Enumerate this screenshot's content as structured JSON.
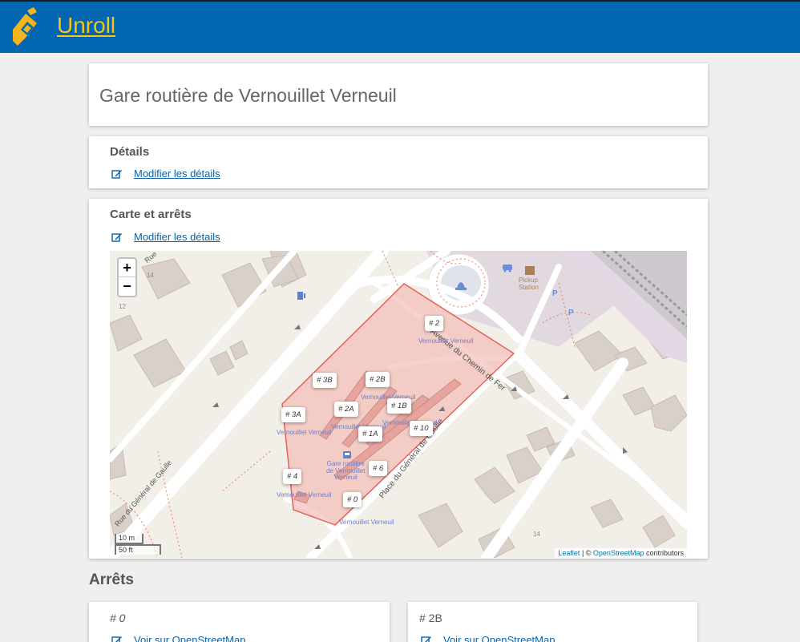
{
  "app": {
    "name": "Unroll"
  },
  "page": {
    "title": "Gare routière de Vernouillet Verneuil"
  },
  "details": {
    "heading": "Détails",
    "edit_link": "Modifier les détails"
  },
  "map_section": {
    "heading": "Carte et arrêts",
    "edit_link": "Modifier les détails",
    "zoom_in": "+",
    "zoom_out": "−",
    "scale_metric": "10 m",
    "scale_imperial": "50 ft",
    "attribution": {
      "leaflet": "Leaflet",
      "sep": " | © ",
      "osm": "OpenStreetMap",
      "suffix": " contributors"
    },
    "street_labels": {
      "avenue": "Avenue du Chemin de Fer",
      "place": "Place du Général de Gaulle",
      "rue_gaulle": "Rue du Général de Gaulle",
      "rue": "Rue",
      "pickup": "Pickup",
      "station": "Station",
      "house_14a": "14",
      "house_12": "12",
      "house_14b": "14"
    },
    "stop_caption": "Vernouillet Verneuil",
    "station_caption": [
      "Gare routière",
      "de Vernouillet",
      "Verneuil"
    ],
    "markers": [
      {
        "id": "m2",
        "label": "# 2"
      },
      {
        "id": "m3B",
        "label": "# 3B"
      },
      {
        "id": "m2B",
        "label": "# 2B"
      },
      {
        "id": "m3A",
        "label": "# 3A"
      },
      {
        "id": "m2A",
        "label": "# 2A"
      },
      {
        "id": "m1B",
        "label": "# 1B"
      },
      {
        "id": "m1A",
        "label": "# 1A"
      },
      {
        "id": "m10",
        "label": "# 10"
      },
      {
        "id": "m6",
        "label": "# 6"
      },
      {
        "id": "m4",
        "label": "# 4"
      },
      {
        "id": "m0",
        "label": "# 0"
      }
    ]
  },
  "stops": {
    "heading": "Arrêts",
    "items": [
      {
        "title": "# 0",
        "link": "Voir sur OpenStreetMap"
      },
      {
        "title": "# 2B",
        "link": "Voir sur OpenStreetMap"
      }
    ]
  }
}
